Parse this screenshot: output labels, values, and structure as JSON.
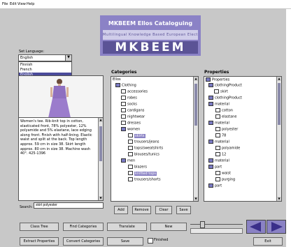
{
  "menubar": {
    "items": [
      "File",
      "Edit",
      "View",
      "Help"
    ]
  },
  "banner": {
    "title": "MKBEEM Ellos Cataloguing",
    "strip_text": "Multilingual Knowledge Based European Electronic Marketplace",
    "logo": "MKBEEM"
  },
  "language": {
    "label": "Set Language:",
    "selected": "English",
    "options": [
      "Finnish",
      "French",
      "English"
    ]
  },
  "description": {
    "text": "Women's tee. Rib-knit top in cotton, elasticated front, 78% polyester, 12% polyamide and 5% elastane, lace edging along front. Finish with half-lining. Elastic waist and split at the back. Top length approx. 59 cm in size 38. Skirt length approx. 80 cm in size 38. Machine wash 40°. 425-1396"
  },
  "categories": {
    "title": "Categories",
    "nodes": [
      {
        "label": "Ellos",
        "icon": "root"
      },
      {
        "label": "Clothing",
        "icon": "folder"
      },
      {
        "label": "accessories",
        "icon": "doc"
      },
      {
        "label": "robes",
        "icon": "doc"
      },
      {
        "label": "socks",
        "icon": "doc"
      },
      {
        "label": "cardigans",
        "icon": "doc"
      },
      {
        "label": "nightwear",
        "icon": "doc"
      },
      {
        "label": "dresses",
        "icon": "doc"
      },
      {
        "label": "women",
        "icon": "folder"
      },
      {
        "label": "skirts",
        "icon": "doc"
      },
      {
        "label": "trousers/jeans",
        "icon": "doc"
      },
      {
        "label": "tops/sweatshirts",
        "icon": "doc"
      },
      {
        "label": "blouses/tunics",
        "icon": "doc"
      },
      {
        "label": "men",
        "icon": "folder"
      },
      {
        "label": "blazers",
        "icon": "doc"
      },
      {
        "label": "knitted tops",
        "icon": "doc"
      },
      {
        "label": "trousers/shorts",
        "icon": "doc"
      }
    ],
    "highlighted": [
      "skirts",
      "knitted tops"
    ]
  },
  "properties": {
    "title": "Properties",
    "nodes": [
      {
        "label": "Properties",
        "icon": "root"
      },
      {
        "label": "clothingProduct",
        "icon": "folder"
      },
      {
        "label": "skirt",
        "icon": "doc"
      },
      {
        "label": "clothingProduct",
        "icon": "folder"
      },
      {
        "label": "material",
        "icon": "folder"
      },
      {
        "label": "cotton",
        "icon": "doc"
      },
      {
        "label": "elastane",
        "icon": "doc"
      },
      {
        "label": "material",
        "icon": "folder"
      },
      {
        "label": "polyester",
        "icon": "doc"
      },
      {
        "label": "78",
        "icon": "doc"
      },
      {
        "label": "material",
        "icon": "folder"
      },
      {
        "label": "polyamide",
        "icon": "doc"
      },
      {
        "label": "12",
        "icon": "doc"
      },
      {
        "label": "material",
        "icon": "folder"
      },
      {
        "label": "part",
        "icon": "folder"
      },
      {
        "label": "waist",
        "icon": "doc"
      },
      {
        "label": "purging",
        "icon": "doc"
      },
      {
        "label": "part",
        "icon": "folder"
      }
    ]
  },
  "search": {
    "label": "Search:",
    "value": "skirt polyester"
  },
  "buttons": {
    "add": "Add",
    "remove": "Remove",
    "clear": "Clear",
    "save_small": "Save",
    "class_tree": "Class Tree",
    "find_categories": "Find Categories",
    "translate": "Translate",
    "new": "New",
    "extract_properties": "Extract Properties",
    "convert_categories": "Convert Categories",
    "save": "Save",
    "finished": "Finished",
    "exit": "Exit"
  },
  "slider_value": 0.2,
  "colors": {
    "accent": "#8b82c6",
    "selection": "#4a4a9a",
    "background": "#c8c8c8"
  }
}
